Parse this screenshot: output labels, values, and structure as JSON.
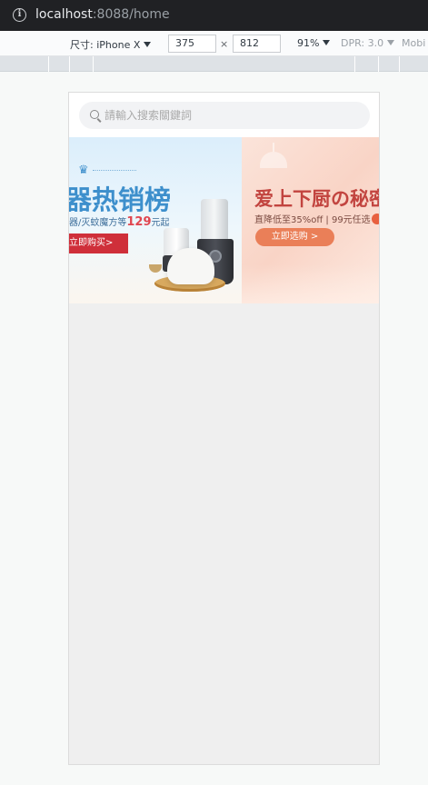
{
  "browser": {
    "url_host": "localhost",
    "url_rest": ":8088/home",
    "info_icon": "i"
  },
  "device_toolbar": {
    "device_label": "尺寸: iPhone X",
    "width_value": "375",
    "times": "×",
    "height_value": "812",
    "zoom": "91%",
    "dpr": "DPR: 3.0",
    "mode": "Mobi"
  },
  "search": {
    "placeholder": "請輸入搜索關鍵詞"
  },
  "banner": {
    "slides": [
      {
        "title": "器热销榜",
        "subtitle_prefix": "器/灭蚊魔方等",
        "price": "129",
        "subtitle_suffix": "元起",
        "button": "立即购买>"
      },
      {
        "title": "爱上下厨の秘密",
        "subtitle": "直降低至35%off | 99元任选",
        "button": "立即选购 >"
      }
    ]
  },
  "colors": {
    "slide1_accent": "#3d8fcc",
    "slide1_button": "#cf2f3a",
    "slide2_accent": "#c2443f",
    "slide2_button": "#ea7f58"
  }
}
